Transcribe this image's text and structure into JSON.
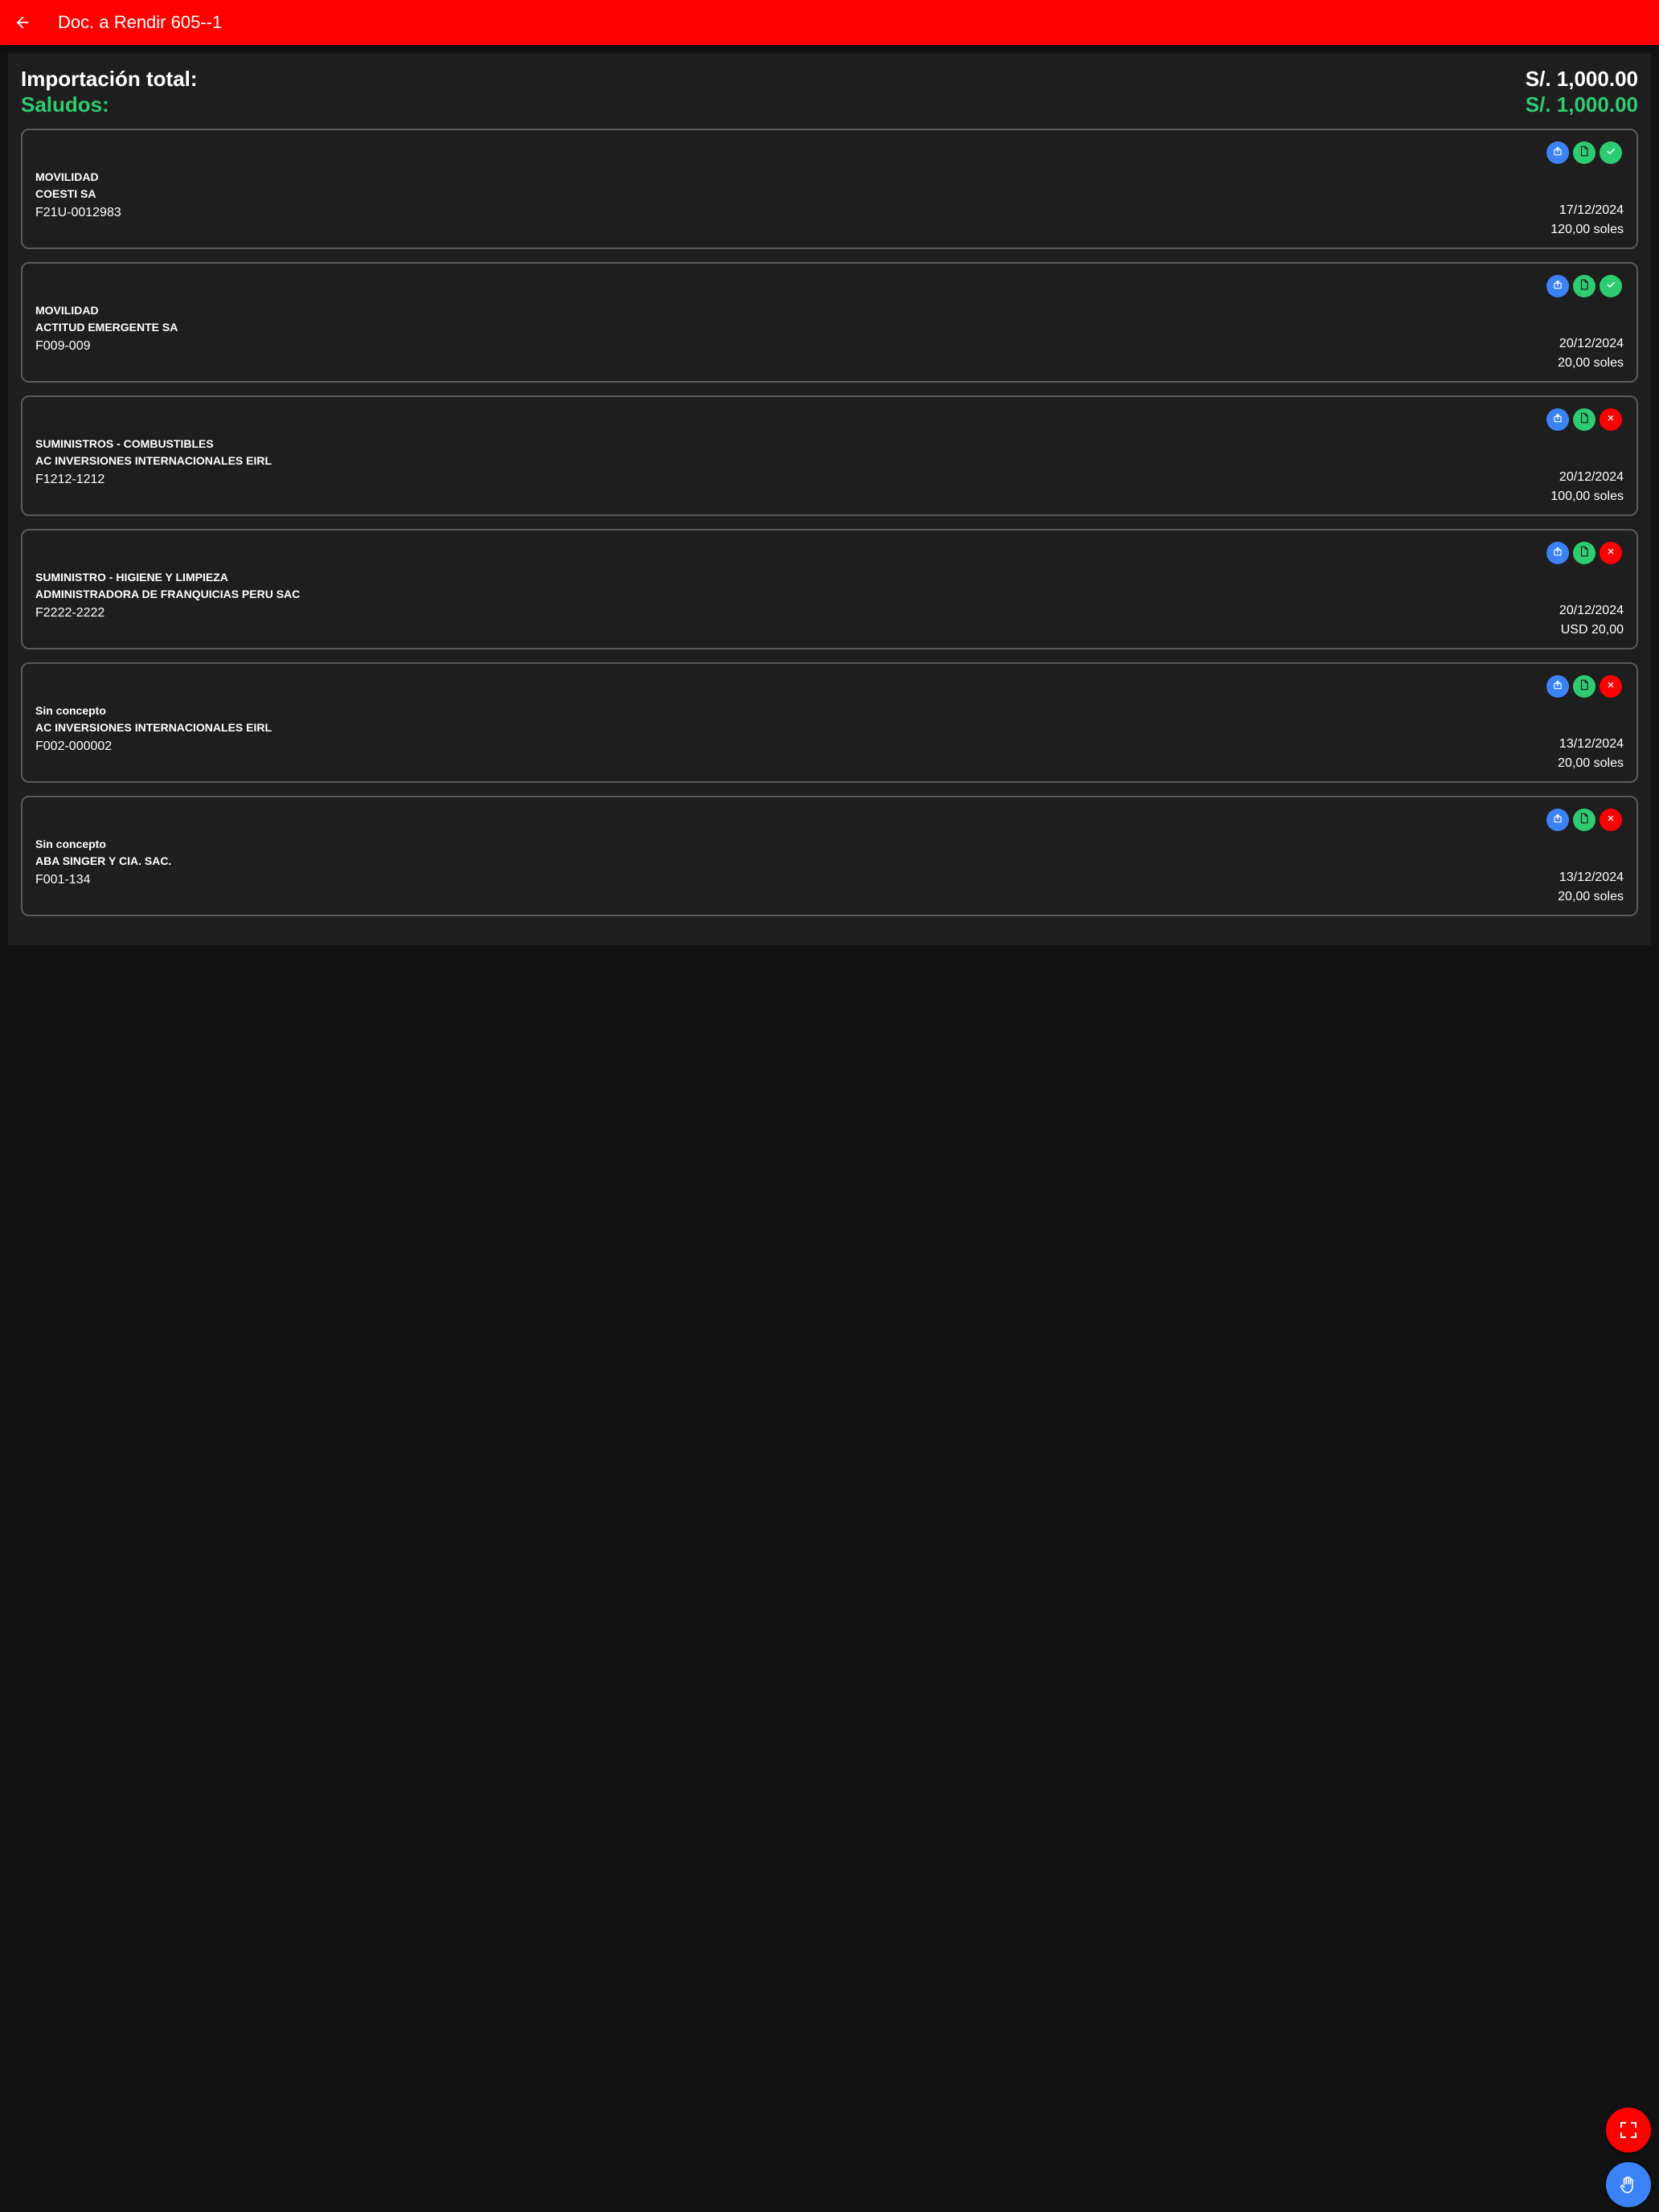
{
  "header": {
    "title": "Doc. a Rendir 605--1",
    "back_icon": "arrow-left-icon",
    "color": "#ff0000"
  },
  "summary": {
    "total_label": "Importación total:",
    "total_value": "S/. 1,000.00",
    "balance_label": "Saludos:",
    "balance_value": "S/. 1,000.00",
    "balance_color": "#2ecc71"
  },
  "documents": [
    {
      "concept": "MOVILIDAD",
      "vendor": "COESTI SA",
      "number": "F21U-0012983",
      "date": "17/12/2024",
      "amount": "120,00 soles",
      "status": "approved"
    },
    {
      "concept": "MOVILIDAD",
      "vendor": "ACTITUD EMERGENTE SA",
      "number": "F009-009",
      "date": "20/12/2024",
      "amount": "20,00 soles",
      "status": "approved"
    },
    {
      "concept": "SUMINISTROS - COMBUSTIBLES",
      "vendor": "AC INVERSIONES INTERNACIONALES EIRL",
      "number": "F1212-1212",
      "date": "20/12/2024",
      "amount": "100,00 soles",
      "status": "rejected"
    },
    {
      "concept": "SUMINISTRO - HIGIENE Y LIMPIEZA",
      "vendor": "ADMINISTRADORA DE FRANQUICIAS PERU SAC",
      "number": "F2222-2222",
      "date": "20/12/2024",
      "amount": "USD 20,00",
      "status": "rejected"
    },
    {
      "concept": "Sin concepto",
      "vendor": "AC INVERSIONES INTERNACIONALES EIRL",
      "number": "F002-000002",
      "date": "13/12/2024",
      "amount": "20,00 soles",
      "status": "rejected"
    },
    {
      "concept": "Sin concepto",
      "vendor": "ABA SINGER Y CIA. SAC.",
      "number": "F001-134",
      "date": "13/12/2024",
      "amount": "20,00 soles",
      "status": "rejected"
    }
  ],
  "card_icons": {
    "upload": "upload-icon",
    "file": "file-icon",
    "approved": "check-icon",
    "rejected": "close-icon"
  },
  "fabs": {
    "expand_icon": "fullscreen-icon",
    "hand_icon": "hand-icon"
  },
  "colors": {
    "background": "#121212",
    "surface": "#1e1e1e",
    "blue": "#3b82f6",
    "green": "#2ecc71",
    "red": "#ff0000"
  }
}
